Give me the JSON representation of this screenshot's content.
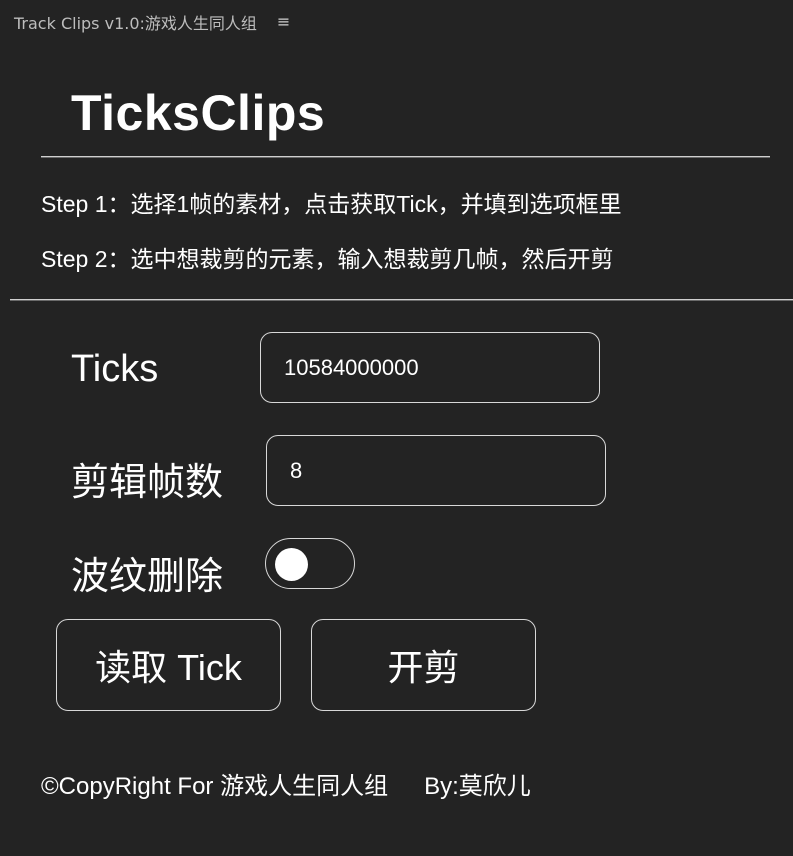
{
  "window": {
    "title": "Track Clips v1.0:游戏人生同人组",
    "menu_icon": "hamburger-menu-icon"
  },
  "header": {
    "title": "TicksClips"
  },
  "steps": [
    "Step 1：选择1帧的素材，点击获取Tick，并填到选项框里",
    "Step 2：选中想裁剪的元素，输入想裁剪几帧，然后开剪"
  ],
  "form": {
    "ticks_label": "Ticks",
    "ticks_value": "10584000000",
    "frames_label": "剪辑帧数",
    "frames_value": "8",
    "ripple_label": "波纹删除",
    "ripple_enabled": false
  },
  "buttons": {
    "read_tick": "读取 Tick",
    "cut": "开剪"
  },
  "footer": {
    "copyright": "©CopyRight For 游戏人生同人组",
    "author": "By:莫欣儿"
  },
  "colors": {
    "background": "#232323",
    "text": "#ffffff",
    "border": "#d8d8d8"
  }
}
